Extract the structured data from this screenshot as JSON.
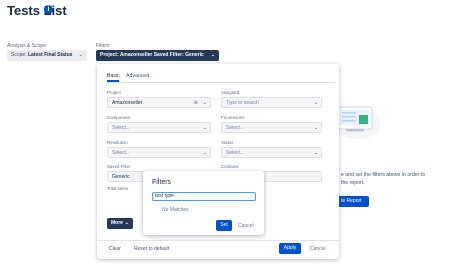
{
  "page": {
    "title": "Tests List",
    "info_icon": "info-icon"
  },
  "scope": {
    "label": "Analysis & Scope",
    "button_prefix": "Scope: ",
    "button_value": "Latest Final Status"
  },
  "filters": {
    "label": "Filters",
    "button_text": "Project: Amazonseller Saved Filter: Generic"
  },
  "panel": {
    "tabs": [
      {
        "label": "Basic",
        "active": true
      },
      {
        "label": "Advanced",
        "active": false
      }
    ],
    "fields": {
      "project": {
        "label": "Project",
        "value": "Amazonseller"
      },
      "assigned": {
        "label": "Assigned",
        "placeholder": "Type to search"
      },
      "component": {
        "label": "Component",
        "placeholder": "Select..."
      },
      "fix_versions": {
        "label": "Fix versions",
        "placeholder": "Select..."
      },
      "resolution": {
        "label": "Resolution",
        "placeholder": "Select..."
      },
      "status": {
        "label": "Status",
        "placeholder": "Select..."
      },
      "saved_filter": {
        "label": "Saved Filter",
        "value": "Generic"
      },
      "contains": {
        "label": "Contains"
      },
      "total_items": {
        "label": "Total items"
      }
    },
    "more_label": "More",
    "footer": {
      "clear": "Clear",
      "reset": "Reset to default",
      "apply": "Apply",
      "cancel": "Cancel"
    }
  },
  "popover": {
    "title": "Filters",
    "input_value": "test type",
    "no_matches": "No Matches",
    "set": "Set",
    "cancel": "Cancel"
  },
  "background": {
    "line1": "e and set the filters above in order to",
    "line2": "the report.",
    "report_button": "te Report"
  },
  "colors": {
    "primary": "#0052cc",
    "dark_button": "#253858",
    "text": "#172b4d"
  }
}
